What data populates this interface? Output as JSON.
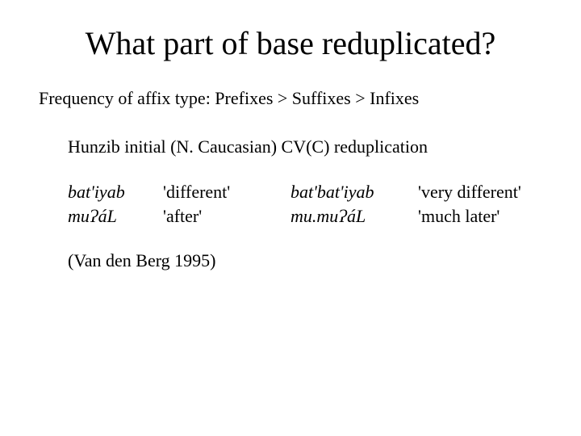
{
  "title": "What part of base reduplicated?",
  "frequency_line": "Frequency of affix type: Prefixes > Suffixes > Infixes",
  "example_heading": "Hunzib initial (N. Caucasian) CV(C) reduplication",
  "rows": [
    {
      "base": "bat'iyab",
      "gloss": "'different'",
      "redup": "bat'bat'iyab",
      "redup_gloss": "'very different'"
    },
    {
      "base": "muɁáL",
      "gloss": "'after'",
      "redup": "mu.muɁáL",
      "redup_gloss": "'much later'"
    }
  ],
  "citation": "(Van den Berg 1995)"
}
